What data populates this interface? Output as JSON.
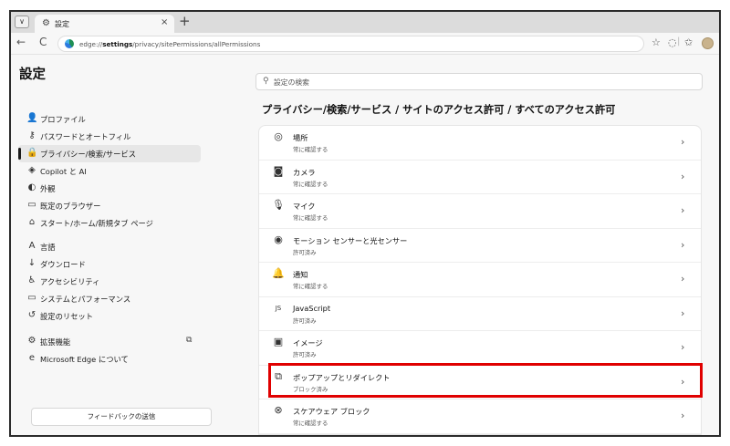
{
  "tab": {
    "title": "設定",
    "new_tab": "+",
    "close": "×",
    "menu": "∨"
  },
  "toolbar": {
    "back": "←",
    "reload": "C",
    "url_scheme": "edge://",
    "url_host": "settings",
    "url_path": "/privacy/sitePermissions/allPermissions"
  },
  "sidebar": {
    "title": "設定",
    "items": [
      {
        "icon": "👤",
        "label": "プロファイル"
      },
      {
        "icon": "⚷",
        "label": "パスワードとオートフィル"
      },
      {
        "icon": "🔒",
        "label": "プライバシー/検索/サービス"
      },
      {
        "icon": "◈",
        "label": "Copilot と AI"
      },
      {
        "icon": "◐",
        "label": "外観"
      },
      {
        "icon": "▭",
        "label": "既定のブラウザー"
      },
      {
        "icon": "⌂",
        "label": "スタート/ホーム/新規タブ ページ"
      },
      {
        "icon": "A",
        "label": "言語"
      },
      {
        "icon": "↓",
        "label": "ダウンロード"
      },
      {
        "icon": "♿",
        "label": "アクセシビリティ"
      },
      {
        "icon": "▭",
        "label": "システムとパフォーマンス"
      },
      {
        "icon": "↺",
        "label": "設定のリセット"
      },
      {
        "icon": "⚙",
        "label": "拡張機能"
      },
      {
        "icon": "e",
        "label": "Microsoft Edge について"
      }
    ],
    "feedback_label": "フィードバックの送信"
  },
  "search": {
    "placeholder": "設定の検索"
  },
  "page": {
    "heading": "プライバシー/検索/サービス / サイトのアクセス許可 / すべてのアクセス許可"
  },
  "permissions": [
    {
      "icon": "◎",
      "name": "場所",
      "status": "常に確認する"
    },
    {
      "icon": "◙",
      "name": "カメラ",
      "status": "常に確認する"
    },
    {
      "icon": "🎙",
      "name": "マイク",
      "status": "常に確認する"
    },
    {
      "icon": "◉",
      "name": "モーション センサーと光センサー",
      "status": "許可済み"
    },
    {
      "icon": "🔔",
      "name": "通知",
      "status": "常に確認する"
    },
    {
      "icon": "JS",
      "name": "JavaScript",
      "status": "許可済み"
    },
    {
      "icon": "▣",
      "name": "イメージ",
      "status": "許可済み"
    },
    {
      "icon": "⧉",
      "name": "ポップアップとリダイレクト",
      "status": "ブロック済み"
    },
    {
      "icon": "⊗",
      "name": "スケアウェア ブロック",
      "status": "常に確認する"
    }
  ],
  "chevron": "›",
  "colors": {
    "highlight": "#e00000",
    "active_bg": "#e7e7e7"
  }
}
